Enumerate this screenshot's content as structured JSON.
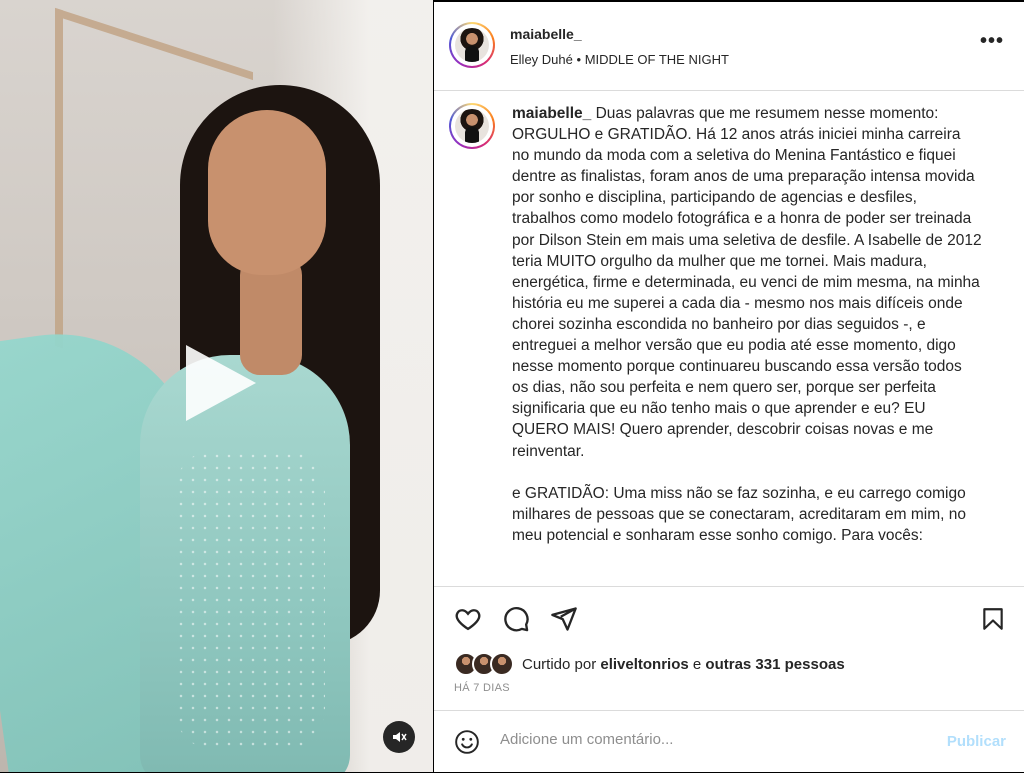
{
  "post": {
    "username": "maiabelle_",
    "audio_artist": "Elley Duhé",
    "audio_sep": "•",
    "audio_title": "MIDDLE OF THE NIGHT",
    "more_label": "•••",
    "caption_text": "Duas palavras que me resumem nesse momento: ORGULHO e GRATIDÃO. Há 12 anos atrás iniciei minha carreira no mundo da moda com a seletiva do Menina Fantástico e fiquei dentre as finalistas, foram anos de uma preparação intensa movida por sonho e disciplina, participando de agencias e desfiles, trabalhos como modelo fotográfica e a honra de poder ser treinada por Dilson Stein em mais uma seletiva de desfile. A Isabelle de 2012 teria MUITO orgulho da mulher que me tornei. Mais madura, energética, firme e determinada, eu venci de mim mesma, na minha história eu me superei a cada dia - mesmo nos mais difíceis onde chorei sozinha escondida no banheiro por dias seguidos -, e entreguei a melhor versão que eu podia até esse momento, digo nesse momento porque continuareu buscando essa versão todos os dias, não sou perfeita e nem quero ser, porque ser perfeita significaria que eu não tenho mais o que aprender e eu? EU\nQUERO MAIS! Quero aprender, descobrir coisas novas e me reinventar.\n\ne GRATIDÃO: Uma miss não se faz sozinha, e eu carrego comigo milhares de pessoas que se conectaram, acreditaram em mim, no meu potencial e sonharam esse sonho comigo. Para vocês:"
  },
  "likes": {
    "prefix": "Curtido por",
    "user": "eliveltonrios",
    "connector": "e",
    "others": "outras 331 pessoas"
  },
  "date_label": "HÁ 7 DIAS",
  "comment": {
    "placeholder": "Adicione um comentário...",
    "publish_label": "Publicar"
  },
  "icons": {
    "like": "heart-icon",
    "comment": "comment-icon",
    "share": "paper-plane-icon",
    "save": "bookmark-icon",
    "emoji": "emoji-icon",
    "play": "play-icon",
    "mute": "speaker-muted-icon"
  },
  "colors": {
    "publish_disabled": "#b2dffc",
    "secondary_text": "#8e8e8e",
    "border": "#dbdbdb"
  }
}
